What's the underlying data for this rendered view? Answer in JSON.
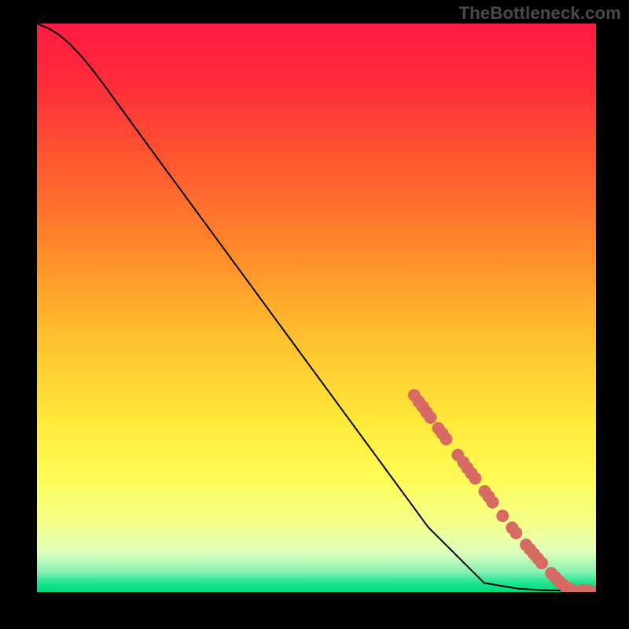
{
  "watermark": "TheBottleneck.com",
  "chart_data": {
    "type": "line",
    "title": "",
    "xlabel": "",
    "ylabel": "",
    "xlim": [
      0,
      100
    ],
    "ylim": [
      0,
      100
    ],
    "grid": false,
    "legend": false,
    "gradient_stops": [
      {
        "offset": 0.0,
        "color": "#ff1a44"
      },
      {
        "offset": 0.1,
        "color": "#ff2b3b"
      },
      {
        "offset": 0.25,
        "color": "#ff5a2f"
      },
      {
        "offset": 0.4,
        "color": "#ff8a2a"
      },
      {
        "offset": 0.55,
        "color": "#ffbf2f"
      },
      {
        "offset": 0.7,
        "color": "#ffe93a"
      },
      {
        "offset": 0.8,
        "color": "#fffb55"
      },
      {
        "offset": 0.88,
        "color": "#f4ff8a"
      },
      {
        "offset": 0.93,
        "color": "#dfffba"
      },
      {
        "offset": 0.965,
        "color": "#86f0b4"
      },
      {
        "offset": 0.985,
        "color": "#17e38c"
      },
      {
        "offset": 1.0,
        "color": "#00d97e"
      }
    ],
    "series": [
      {
        "name": "curve",
        "color": "#000000",
        "stroke_width": 2,
        "x": [
          0,
          2,
          4,
          6,
          8,
          10,
          12,
          14,
          16,
          18,
          20,
          30,
          40,
          50,
          60,
          70,
          80,
          86,
          90,
          92,
          94,
          96,
          98,
          100
        ],
        "y": [
          100,
          99.2,
          98.0,
          96.3,
          94.2,
          91.8,
          89.2,
          86.5,
          83.8,
          81.1,
          78.4,
          65.0,
          51.6,
          38.2,
          24.8,
          11.4,
          1.6,
          0.6,
          0.35,
          0.3,
          0.3,
          0.3,
          0.3,
          0.3
        ]
      }
    ],
    "scatter": {
      "name": "highlight-points",
      "color": "#d76a63",
      "radius": 8,
      "points": [
        {
          "x": 67.5,
          "y": 34.6
        },
        {
          "x": 68.3,
          "y": 33.5
        },
        {
          "x": 69.0,
          "y": 32.6
        },
        {
          "x": 69.7,
          "y": 31.6
        },
        {
          "x": 70.4,
          "y": 30.7
        },
        {
          "x": 71.8,
          "y": 28.8
        },
        {
          "x": 72.5,
          "y": 27.9
        },
        {
          "x": 73.2,
          "y": 26.9
        },
        {
          "x": 75.3,
          "y": 24.1
        },
        {
          "x": 76.3,
          "y": 22.8
        },
        {
          "x": 77.0,
          "y": 21.8
        },
        {
          "x": 77.7,
          "y": 20.9
        },
        {
          "x": 78.4,
          "y": 20.0
        },
        {
          "x": 80.1,
          "y": 17.7
        },
        {
          "x": 80.8,
          "y": 16.8
        },
        {
          "x": 81.5,
          "y": 15.8
        },
        {
          "x": 83.3,
          "y": 13.4
        },
        {
          "x": 85.0,
          "y": 11.3
        },
        {
          "x": 85.7,
          "y": 10.4
        },
        {
          "x": 87.5,
          "y": 8.3
        },
        {
          "x": 88.2,
          "y": 7.5
        },
        {
          "x": 88.9,
          "y": 6.7
        },
        {
          "x": 89.6,
          "y": 5.9
        },
        {
          "x": 90.3,
          "y": 5.1
        },
        {
          "x": 92.0,
          "y": 3.3
        },
        {
          "x": 92.7,
          "y": 2.6
        },
        {
          "x": 93.4,
          "y": 1.9
        },
        {
          "x": 94.1,
          "y": 1.3
        },
        {
          "x": 94.8,
          "y": 0.8
        },
        {
          "x": 95.5,
          "y": 0.5
        },
        {
          "x": 97.5,
          "y": 0.3
        },
        {
          "x": 98.5,
          "y": 0.3
        },
        {
          "x": 100.5,
          "y": 0.3
        },
        {
          "x": 103.0,
          "y": 0.3
        },
        {
          "x": 104.0,
          "y": 0.3
        }
      ]
    }
  }
}
